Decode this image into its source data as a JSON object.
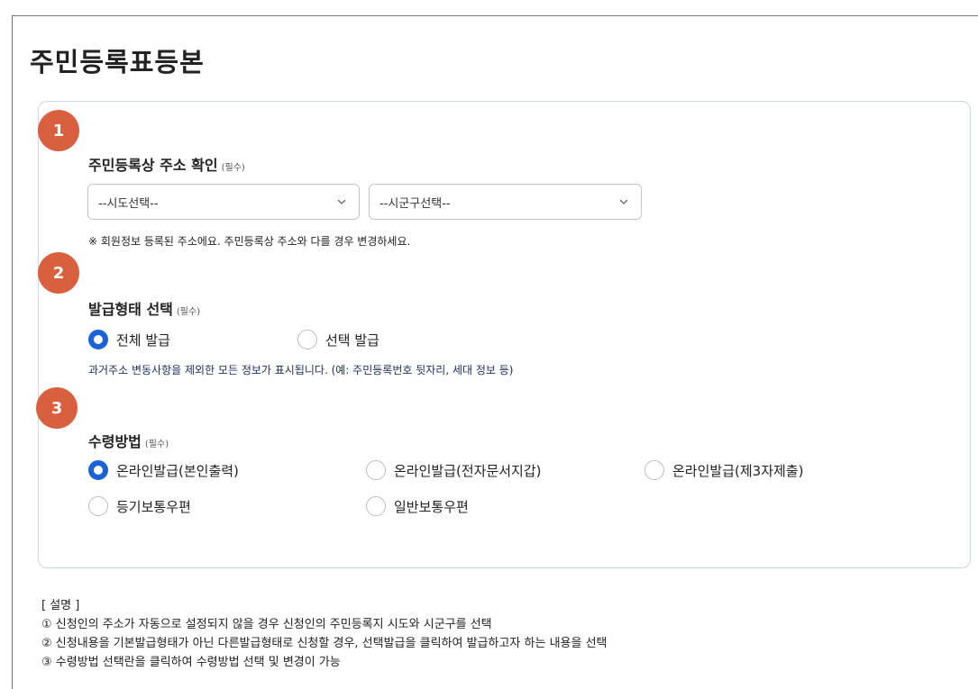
{
  "page": {
    "title": "주민등록표등본"
  },
  "step1": {
    "number": "1",
    "label": "주민등록상 주소 확인",
    "required": "(필수)",
    "sido_select": "--시도선택--",
    "sigungu_select": "--시군구선택--",
    "note": "※ 회원정보 등록된 주소에요. 주민등록상 주소와 다를 경우 변경하세요."
  },
  "step2": {
    "number": "2",
    "label": "발급형태 선택",
    "required": "(필수)",
    "options": [
      {
        "label": "전체 발급",
        "checked": true
      },
      {
        "label": "선택 발급",
        "checked": false
      }
    ],
    "note": "과거주소 변동사항을 제외한 모든 정보가 표시됩니다. (예: 주민등록번호 뒷자리, 세대 정보 등)"
  },
  "step3": {
    "number": "3",
    "label": "수령방법",
    "required": "(필수)",
    "options": [
      {
        "label": "온라인발급(본인출력)",
        "checked": true
      },
      {
        "label": "온라인발급(전자문서지갑)",
        "checked": false
      },
      {
        "label": "온라인발급(제3자제출)",
        "checked": false
      },
      {
        "label": "등기보통우편",
        "checked": false
      },
      {
        "label": "일반보통우편",
        "checked": false
      }
    ]
  },
  "description": {
    "header": "[ 설명 ]",
    "lines": [
      "① 신청인의 주소가 자동으로 설정되지 않을 경우 신청인의 주민등록지 시도와 시군구를 선택",
      "② 신청내용을 기본발급형태가 아닌 다른발급형태로 신청할 경우, 선택발급을 클릭하여 발급하고자 하는 내용을 선택",
      "③ 수령방법 선택란을 클릭하여 수령방법 선택 및 변경이 가능"
    ]
  },
  "colors": {
    "accent": "#1a63d6",
    "badge": "#d9603f",
    "border": "#c9d6ea"
  }
}
